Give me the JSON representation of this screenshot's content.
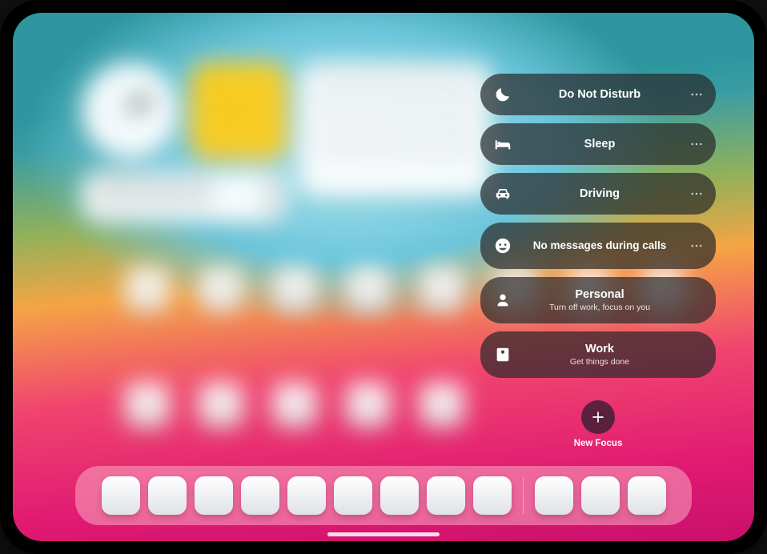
{
  "focus": {
    "items": [
      {
        "id": "dnd",
        "title": "Do Not Disturb",
        "subtitle": "",
        "icon": "moon",
        "has_more": true
      },
      {
        "id": "sleep",
        "title": "Sleep",
        "subtitle": "",
        "icon": "bed",
        "has_more": true
      },
      {
        "id": "driving",
        "title": "Driving",
        "subtitle": "",
        "icon": "car",
        "has_more": true
      },
      {
        "id": "nomsg",
        "title": "No messages during calls",
        "subtitle": "",
        "icon": "smiley",
        "has_more": true
      },
      {
        "id": "personal",
        "title": "Personal",
        "subtitle": "Turn off work, focus on you",
        "icon": "person",
        "has_more": false
      },
      {
        "id": "work",
        "title": "Work",
        "subtitle": "Get things done",
        "icon": "badge",
        "has_more": false
      }
    ],
    "new_label": "New Focus"
  }
}
